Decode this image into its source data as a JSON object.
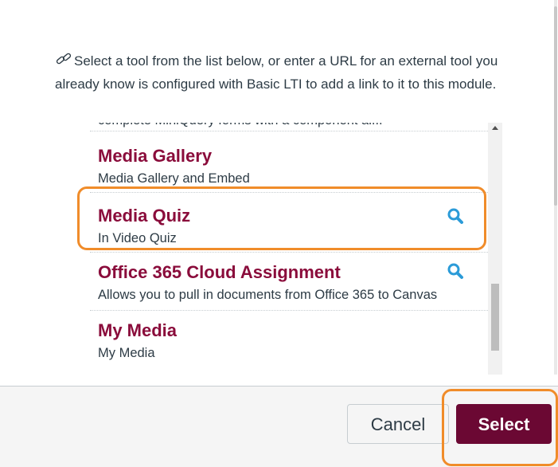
{
  "instructions": "Select a tool from the list below, or enter a URL for an external tool you already know is configured with Basic LTI to add a link to it to this module.",
  "tools": [
    {
      "name": "",
      "description": "complete MiniQuery forms with a component al..."
    },
    {
      "name": "Media Gallery",
      "description": "Media Gallery and Embed"
    },
    {
      "name": "Media Quiz",
      "description": "In Video Quiz"
    },
    {
      "name": "Office 365 Cloud Assignment",
      "description": "Allows you to pull in documents from Office 365 to Canvas"
    },
    {
      "name": "My Media",
      "description": "My Media"
    }
  ],
  "footer": {
    "cancel_label": "Cancel",
    "select_label": "Select"
  },
  "colors": {
    "tool_name": "#8a0c3b",
    "select_bg": "#6b0833",
    "highlight": "#f08c2a",
    "search_icon": "#2b9bd8"
  },
  "icons": {
    "link": "link-icon",
    "search": "search-icon"
  }
}
